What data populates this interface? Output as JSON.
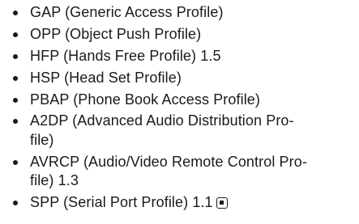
{
  "profiles": [
    {
      "label": "GAP (Generic Access Profile)"
    },
    {
      "label": "OPP (Object Push Profile)"
    },
    {
      "label": "HFP (Hands Free Profile) 1.5"
    },
    {
      "label": "HSP (Head Set Profile)"
    },
    {
      "label": "PBAP (Phone Book Access Profile)"
    },
    {
      "label_line1": "A2DP (Advanced Audio Distribution Pro-",
      "label_line2": "file)"
    },
    {
      "label_line1": "AVRCP (Audio/Video Remote Control Pro-",
      "label_line2": "file) 1.3"
    },
    {
      "label": "SPP (Serial Port Profile) 1.1",
      "icon": "square-note-icon"
    }
  ]
}
